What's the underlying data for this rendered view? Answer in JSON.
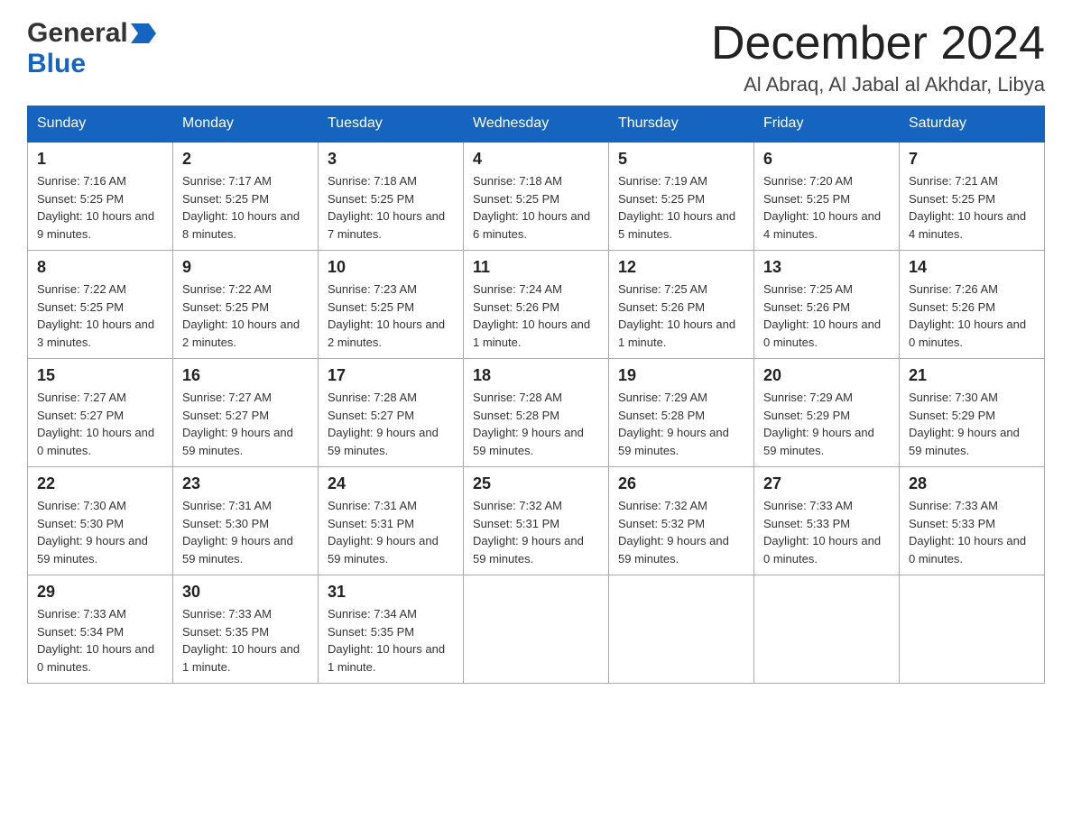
{
  "header": {
    "logo": {
      "line1": "General",
      "arrow": "▶",
      "line2": "Blue"
    },
    "title": "December 2024",
    "location": "Al Abraq, Al Jabal al Akhdar, Libya"
  },
  "days_of_week": [
    "Sunday",
    "Monday",
    "Tuesday",
    "Wednesday",
    "Thursday",
    "Friday",
    "Saturday"
  ],
  "weeks": [
    [
      {
        "day": "1",
        "sunrise": "7:16 AM",
        "sunset": "5:25 PM",
        "daylight": "10 hours and 9 minutes."
      },
      {
        "day": "2",
        "sunrise": "7:17 AM",
        "sunset": "5:25 PM",
        "daylight": "10 hours and 8 minutes."
      },
      {
        "day": "3",
        "sunrise": "7:18 AM",
        "sunset": "5:25 PM",
        "daylight": "10 hours and 7 minutes."
      },
      {
        "day": "4",
        "sunrise": "7:18 AM",
        "sunset": "5:25 PM",
        "daylight": "10 hours and 6 minutes."
      },
      {
        "day": "5",
        "sunrise": "7:19 AM",
        "sunset": "5:25 PM",
        "daylight": "10 hours and 5 minutes."
      },
      {
        "day": "6",
        "sunrise": "7:20 AM",
        "sunset": "5:25 PM",
        "daylight": "10 hours and 4 minutes."
      },
      {
        "day": "7",
        "sunrise": "7:21 AM",
        "sunset": "5:25 PM",
        "daylight": "10 hours and 4 minutes."
      }
    ],
    [
      {
        "day": "8",
        "sunrise": "7:22 AM",
        "sunset": "5:25 PM",
        "daylight": "10 hours and 3 minutes."
      },
      {
        "day": "9",
        "sunrise": "7:22 AM",
        "sunset": "5:25 PM",
        "daylight": "10 hours and 2 minutes."
      },
      {
        "day": "10",
        "sunrise": "7:23 AM",
        "sunset": "5:25 PM",
        "daylight": "10 hours and 2 minutes."
      },
      {
        "day": "11",
        "sunrise": "7:24 AM",
        "sunset": "5:26 PM",
        "daylight": "10 hours and 1 minute."
      },
      {
        "day": "12",
        "sunrise": "7:25 AM",
        "sunset": "5:26 PM",
        "daylight": "10 hours and 1 minute."
      },
      {
        "day": "13",
        "sunrise": "7:25 AM",
        "sunset": "5:26 PM",
        "daylight": "10 hours and 0 minutes."
      },
      {
        "day": "14",
        "sunrise": "7:26 AM",
        "sunset": "5:26 PM",
        "daylight": "10 hours and 0 minutes."
      }
    ],
    [
      {
        "day": "15",
        "sunrise": "7:27 AM",
        "sunset": "5:27 PM",
        "daylight": "10 hours and 0 minutes."
      },
      {
        "day": "16",
        "sunrise": "7:27 AM",
        "sunset": "5:27 PM",
        "daylight": "9 hours and 59 minutes."
      },
      {
        "day": "17",
        "sunrise": "7:28 AM",
        "sunset": "5:27 PM",
        "daylight": "9 hours and 59 minutes."
      },
      {
        "day": "18",
        "sunrise": "7:28 AM",
        "sunset": "5:28 PM",
        "daylight": "9 hours and 59 minutes."
      },
      {
        "day": "19",
        "sunrise": "7:29 AM",
        "sunset": "5:28 PM",
        "daylight": "9 hours and 59 minutes."
      },
      {
        "day": "20",
        "sunrise": "7:29 AM",
        "sunset": "5:29 PM",
        "daylight": "9 hours and 59 minutes."
      },
      {
        "day": "21",
        "sunrise": "7:30 AM",
        "sunset": "5:29 PM",
        "daylight": "9 hours and 59 minutes."
      }
    ],
    [
      {
        "day": "22",
        "sunrise": "7:30 AM",
        "sunset": "5:30 PM",
        "daylight": "9 hours and 59 minutes."
      },
      {
        "day": "23",
        "sunrise": "7:31 AM",
        "sunset": "5:30 PM",
        "daylight": "9 hours and 59 minutes."
      },
      {
        "day": "24",
        "sunrise": "7:31 AM",
        "sunset": "5:31 PM",
        "daylight": "9 hours and 59 minutes."
      },
      {
        "day": "25",
        "sunrise": "7:32 AM",
        "sunset": "5:31 PM",
        "daylight": "9 hours and 59 minutes."
      },
      {
        "day": "26",
        "sunrise": "7:32 AM",
        "sunset": "5:32 PM",
        "daylight": "9 hours and 59 minutes."
      },
      {
        "day": "27",
        "sunrise": "7:33 AM",
        "sunset": "5:33 PM",
        "daylight": "10 hours and 0 minutes."
      },
      {
        "day": "28",
        "sunrise": "7:33 AM",
        "sunset": "5:33 PM",
        "daylight": "10 hours and 0 minutes."
      }
    ],
    [
      {
        "day": "29",
        "sunrise": "7:33 AM",
        "sunset": "5:34 PM",
        "daylight": "10 hours and 0 minutes."
      },
      {
        "day": "30",
        "sunrise": "7:33 AM",
        "sunset": "5:35 PM",
        "daylight": "10 hours and 1 minute."
      },
      {
        "day": "31",
        "sunrise": "7:34 AM",
        "sunset": "5:35 PM",
        "daylight": "10 hours and 1 minute."
      },
      null,
      null,
      null,
      null
    ]
  ],
  "labels": {
    "sunrise": "Sunrise:",
    "sunset": "Sunset:",
    "daylight": "Daylight:"
  }
}
